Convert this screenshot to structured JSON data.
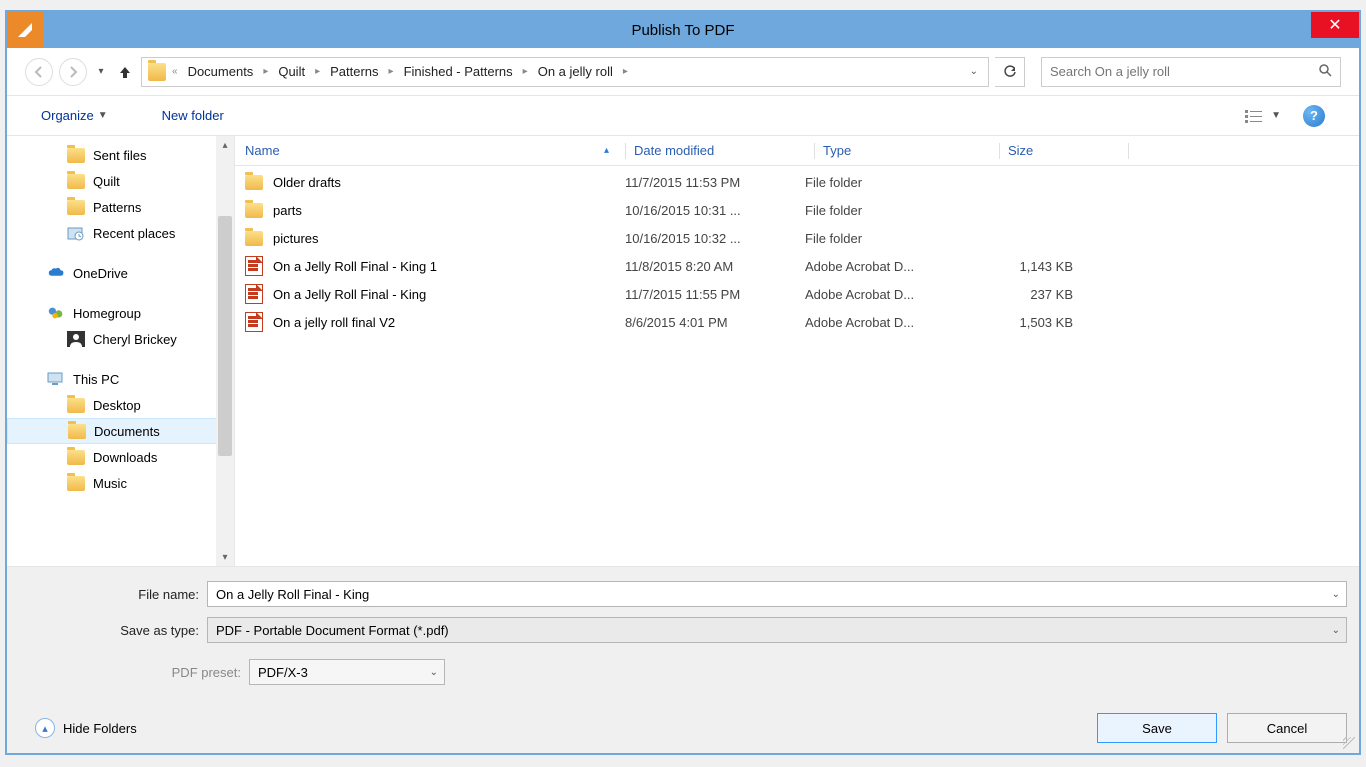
{
  "title": "Publish To PDF",
  "breadcrumb": [
    "Documents",
    "Quilt",
    "Patterns",
    "Finished - Patterns",
    "On a jelly roll"
  ],
  "search_placeholder": "Search On a jelly roll",
  "toolbar": {
    "organize": "Organize",
    "new_folder": "New folder"
  },
  "sidebar": {
    "items": [
      {
        "label": "Sent files",
        "indent": "sub",
        "icon": "folder"
      },
      {
        "label": "Quilt",
        "indent": "sub",
        "icon": "folder"
      },
      {
        "label": "Patterns",
        "indent": "sub",
        "icon": "folder"
      },
      {
        "label": "Recent places",
        "indent": "sub",
        "icon": "recent"
      }
    ],
    "onedrive": "OneDrive",
    "homegroup": "Homegroup",
    "user": "Cheryl Brickey",
    "thispc": "This PC",
    "pc_items": [
      {
        "label": "Desktop"
      },
      {
        "label": "Documents",
        "selected": true
      },
      {
        "label": "Downloads"
      },
      {
        "label": "Music"
      }
    ]
  },
  "columns": {
    "name": "Name",
    "date": "Date modified",
    "type": "Type",
    "size": "Size"
  },
  "files": [
    {
      "name": "Older drafts",
      "date": "11/7/2015 11:53 PM",
      "type": "File folder",
      "size": "",
      "icon": "folder"
    },
    {
      "name": "parts",
      "date": "10/16/2015 10:31 ...",
      "type": "File folder",
      "size": "",
      "icon": "folder"
    },
    {
      "name": "pictures",
      "date": "10/16/2015 10:32 ...",
      "type": "File folder",
      "size": "",
      "icon": "folder"
    },
    {
      "name": "On a Jelly Roll Final - King 1",
      "date": "11/8/2015 8:20 AM",
      "type": "Adobe Acrobat D...",
      "size": "1,143 KB",
      "icon": "pdf"
    },
    {
      "name": "On a Jelly Roll Final - King",
      "date": "11/7/2015 11:55 PM",
      "type": "Adobe Acrobat D...",
      "size": "237 KB",
      "icon": "pdf"
    },
    {
      "name": "On a jelly roll final V2",
      "date": "8/6/2015 4:01 PM",
      "type": "Adobe Acrobat D...",
      "size": "1,503 KB",
      "icon": "pdf"
    }
  ],
  "form": {
    "filename_label": "File name:",
    "filename_value": "On a Jelly Roll Final - King",
    "saveastype_label": "Save as type:",
    "saveastype_value": "PDF - Portable Document Format (*.pdf)",
    "pdfpreset_label": "PDF preset:",
    "pdfpreset_value": "PDF/X-3"
  },
  "buttons": {
    "hide": "Hide Folders",
    "save": "Save",
    "cancel": "Cancel"
  }
}
